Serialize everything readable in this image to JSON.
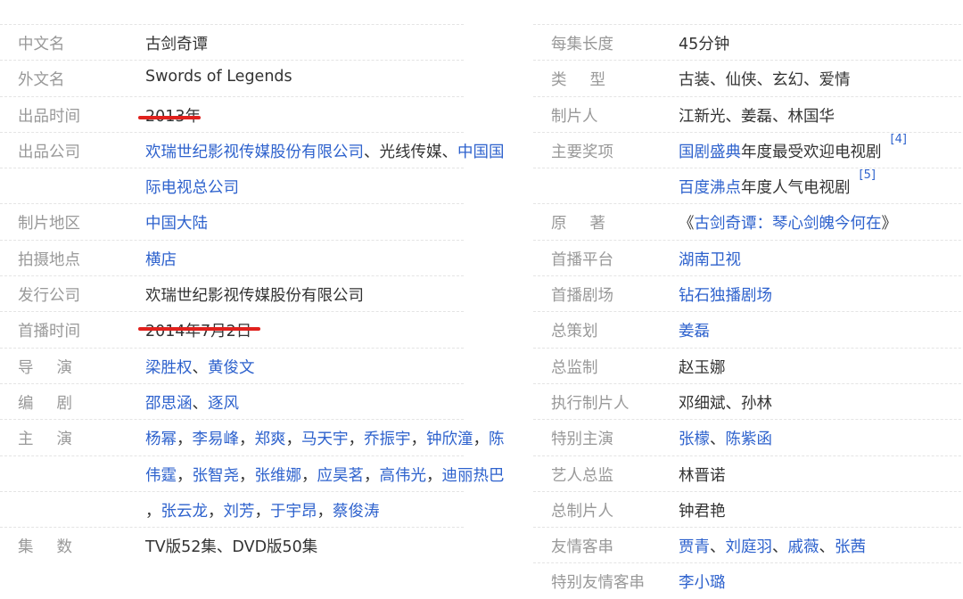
{
  "left": [
    {
      "label": "中文名",
      "value": [
        {
          "t": "古剑奇谭",
          "link": false
        }
      ]
    },
    {
      "label": "外文名",
      "value": [
        {
          "t": "Swords of Legends",
          "link": false
        }
      ]
    },
    {
      "label": "出品时间",
      "value": [
        {
          "t": "2013年",
          "link": false
        }
      ]
    },
    {
      "label": "出品公司",
      "value": [
        {
          "t": "欢瑞世纪影视传媒股份有限公司",
          "link": true
        },
        {
          "t": "、光线传媒、",
          "link": false
        },
        {
          "t": "中国国",
          "link": true
        }
      ]
    },
    {
      "label": "",
      "value": [
        {
          "t": "际电视总公司",
          "link": true
        }
      ]
    },
    {
      "label": "制片地区",
      "value": [
        {
          "t": "中国大陆",
          "link": true
        }
      ]
    },
    {
      "label": "拍摄地点",
      "value": [
        {
          "t": "横店",
          "link": true
        }
      ]
    },
    {
      "label": "发行公司",
      "value": [
        {
          "t": "欢瑞世纪影视传媒股份有限公司",
          "link": false
        }
      ]
    },
    {
      "label": "首播时间",
      "value": [
        {
          "t": "2014年7月2日",
          "link": false
        }
      ]
    },
    {
      "label": "导演",
      "spaced": true,
      "value": [
        {
          "t": "梁胜权",
          "link": true
        },
        {
          "t": "、",
          "link": false
        },
        {
          "t": "黄俊文",
          "link": true
        }
      ]
    },
    {
      "label": "编剧",
      "spaced": true,
      "value": [
        {
          "t": "邵思涵",
          "link": true
        },
        {
          "t": "、",
          "link": false
        },
        {
          "t": "逐风",
          "link": true
        }
      ]
    },
    {
      "label": "主演",
      "spaced": true,
      "value": [
        {
          "t": "杨幂",
          "link": true
        },
        {
          "t": "，",
          "link": false
        },
        {
          "t": "李易峰",
          "link": true
        },
        {
          "t": "，",
          "link": false
        },
        {
          "t": "郑爽",
          "link": true
        },
        {
          "t": "，",
          "link": false
        },
        {
          "t": "马天宇",
          "link": true
        },
        {
          "t": "，",
          "link": false
        },
        {
          "t": "乔振宇",
          "link": true
        },
        {
          "t": "，",
          "link": false
        },
        {
          "t": "钟欣潼",
          "link": true
        },
        {
          "t": "，",
          "link": false
        },
        {
          "t": "陈",
          "link": true
        }
      ]
    },
    {
      "label": "",
      "value": [
        {
          "t": "伟霆",
          "link": true
        },
        {
          "t": "，",
          "link": false
        },
        {
          "t": "张智尧",
          "link": true
        },
        {
          "t": "，",
          "link": false
        },
        {
          "t": "张维娜",
          "link": true
        },
        {
          "t": "，",
          "link": false
        },
        {
          "t": "应昊茗",
          "link": true
        },
        {
          "t": "，",
          "link": false
        },
        {
          "t": "高伟光",
          "link": true
        },
        {
          "t": "，",
          "link": false
        },
        {
          "t": "迪丽热巴",
          "link": true
        }
      ]
    },
    {
      "label": "",
      "value": [
        {
          "t": "，",
          "link": false
        },
        {
          "t": "张云龙",
          "link": true
        },
        {
          "t": "，",
          "link": false
        },
        {
          "t": "刘芳",
          "link": true
        },
        {
          "t": "，",
          "link": false
        },
        {
          "t": "于宇昂",
          "link": true
        },
        {
          "t": "，",
          "link": false
        },
        {
          "t": "蔡俊涛",
          "link": true
        }
      ]
    },
    {
      "label": "集数",
      "spaced": true,
      "value": [
        {
          "t": "TV版52集、DVD版50集",
          "link": false
        }
      ]
    }
  ],
  "right": [
    {
      "label": "每集长度",
      "value": [
        {
          "t": "45分钟",
          "link": false
        }
      ]
    },
    {
      "label": "类型",
      "spaced": true,
      "value": [
        {
          "t": "古装、仙侠、玄幻、爱情",
          "link": false
        }
      ]
    },
    {
      "label": "制片人",
      "value": [
        {
          "t": "江新光、姜磊、林国华",
          "link": false
        }
      ]
    },
    {
      "label": "主要奖项",
      "value": [
        {
          "t": "国剧盛典",
          "link": true
        },
        {
          "t": "年度最受欢迎电视剧",
          "link": false
        }
      ],
      "sup": "[4]"
    },
    {
      "label": "",
      "value": [
        {
          "t": "百度沸点",
          "link": true
        },
        {
          "t": "年度人气电视剧",
          "link": false
        }
      ],
      "sup": "[5]"
    },
    {
      "label": "原著",
      "spaced": true,
      "value": [
        {
          "t": "《",
          "link": false
        },
        {
          "t": "古剑奇谭：琴心剑魄今何在",
          "link": true
        },
        {
          "t": "》",
          "link": false
        }
      ]
    },
    {
      "label": "首播平台",
      "value": [
        {
          "t": "湖南卫视",
          "link": true
        }
      ]
    },
    {
      "label": "首播剧场",
      "value": [
        {
          "t": "钻石独播剧场",
          "link": true
        }
      ]
    },
    {
      "label": "总策划",
      "value": [
        {
          "t": "姜磊",
          "link": true
        }
      ]
    },
    {
      "label": "总监制",
      "value": [
        {
          "t": "赵玉娜",
          "link": false
        }
      ]
    },
    {
      "label": "执行制片人",
      "value": [
        {
          "t": "邓细斌、孙林",
          "link": false
        }
      ]
    },
    {
      "label": "特别主演",
      "value": [
        {
          "t": "张檬",
          "link": true
        },
        {
          "t": "、",
          "link": false
        },
        {
          "t": "陈紫函",
          "link": true
        }
      ]
    },
    {
      "label": "艺人总监",
      "value": [
        {
          "t": "林晋诺",
          "link": false
        }
      ]
    },
    {
      "label": "总制片人",
      "value": [
        {
          "t": "钟君艳",
          "link": false
        }
      ]
    },
    {
      "label": "友情客串",
      "value": [
        {
          "t": "贾青",
          "link": true
        },
        {
          "t": "、",
          "link": false
        },
        {
          "t": "刘庭羽",
          "link": true
        },
        {
          "t": "、",
          "link": false
        },
        {
          "t": "戚薇",
          "link": true
        },
        {
          "t": "、",
          "link": false
        },
        {
          "t": "张茜",
          "link": true
        }
      ]
    },
    {
      "label": "特别友情客串",
      "value": [
        {
          "t": "李小璐",
          "link": true
        }
      ]
    }
  ],
  "highlights": {
    "color": "#e0211d"
  }
}
